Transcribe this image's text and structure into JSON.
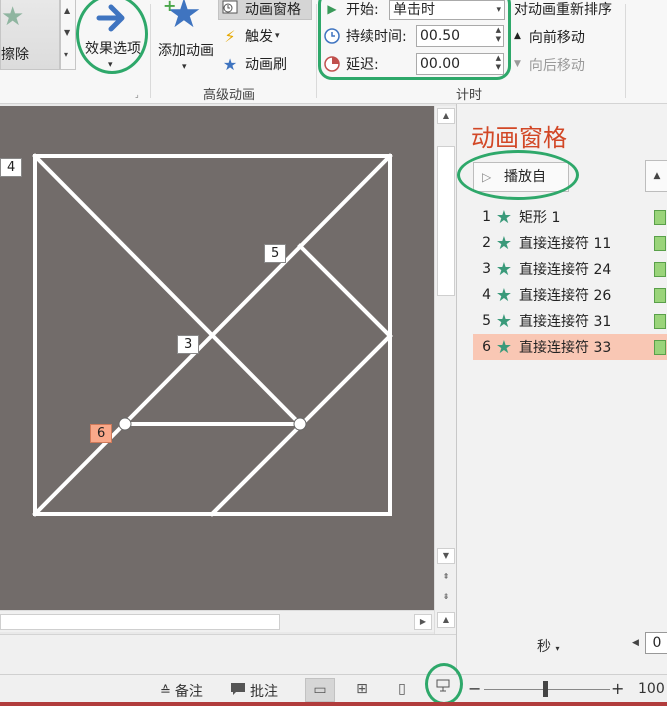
{
  "ribbon": {
    "gallery_label": "擦除",
    "effect_options_label": "效果选项",
    "add_animation_label": "添加动画",
    "advanced": {
      "pane_label": "动画窗格",
      "trigger_label": "触发",
      "painter_label": "动画刷",
      "group_label": "高级动画"
    },
    "timing": {
      "start_label": "开始:",
      "start_value": "单击时",
      "duration_label": "持续时间:",
      "duration_value": "00.50",
      "delay_label": "延迟:",
      "delay_value": "00.00",
      "reorder_title": "对动画重新排序",
      "move_earlier": "向前移动",
      "move_later": "向后移动",
      "group_label": "计时"
    }
  },
  "slide": {
    "tags": [
      "4",
      "5",
      "3",
      "6"
    ]
  },
  "pane": {
    "title": "动画窗格",
    "play_label": "播放自",
    "items": [
      {
        "num": "1",
        "name": "矩形 1"
      },
      {
        "num": "2",
        "name": "直接连接符 11"
      },
      {
        "num": "3",
        "name": "直接连接符 24"
      },
      {
        "num": "4",
        "name": "直接连接符 26"
      },
      {
        "num": "5",
        "name": "直接连接符 31"
      },
      {
        "num": "6",
        "name": "直接连接符 33"
      }
    ],
    "selected_index": 6,
    "seconds_label": "秒",
    "timeline_value": "0"
  },
  "status": {
    "notes_label": "备注",
    "comments_label": "批注",
    "zoom_label": "100"
  },
  "colors": {
    "highlight_green": "#2ea86a",
    "pane_title": "#d24726",
    "selected_row": "#f9c7b4",
    "slide_bg": "#726c6a"
  }
}
